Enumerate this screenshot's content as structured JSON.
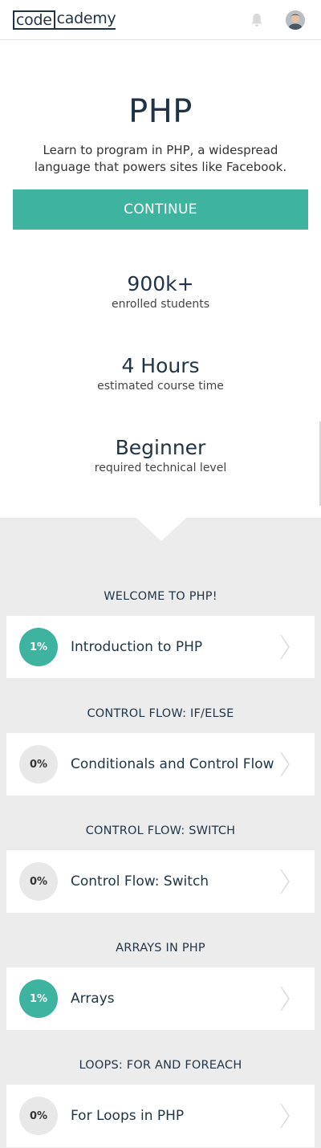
{
  "header": {
    "logo_code": "code",
    "logo_rest": "cademy"
  },
  "course": {
    "title": "PHP",
    "description": "Learn to program in PHP, a widespread language that powers sites like Facebook.",
    "continue_label": "CONTINUE"
  },
  "stats": [
    {
      "value": "900k+",
      "label": "enrolled students"
    },
    {
      "value": "4 Hours",
      "label": "estimated course time"
    },
    {
      "value": "Beginner",
      "label": "required technical level"
    }
  ],
  "sections": [
    {
      "heading": "WELCOME TO PHP!",
      "lesson": "Introduction to PHP",
      "progress": "1%",
      "started": true
    },
    {
      "heading": "CONTROL FLOW: IF/ELSE",
      "lesson": "Conditionals and Control Flow",
      "progress": "0%",
      "started": false
    },
    {
      "heading": "CONTROL FLOW: SWITCH",
      "lesson": "Control Flow: Switch",
      "progress": "0%",
      "started": false
    },
    {
      "heading": "ARRAYS IN PHP",
      "lesson": "Arrays",
      "progress": "1%",
      "started": true
    },
    {
      "heading": "LOOPS: FOR AND FOREACH",
      "lesson": "For Loops in PHP",
      "progress": "0%",
      "started": false
    }
  ],
  "colors": {
    "accent": "#3eb39f",
    "text": "#1f3447",
    "background": "#ececec"
  },
  "icons": {
    "notification": "bell-icon",
    "profile": "avatar",
    "chevron": "chevron-right-icon"
  }
}
